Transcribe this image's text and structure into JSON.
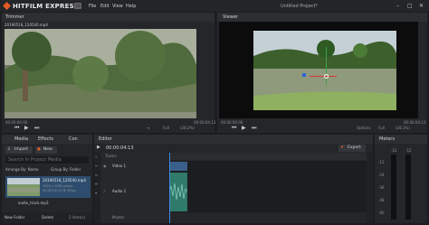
{
  "app": {
    "logo_text": "HITFILM EXPRESS",
    "logo_badge": "10",
    "menu": [
      "File",
      "Edit",
      "View",
      "Help"
    ],
    "document_title": "Untitled Project*"
  },
  "trimmer": {
    "tab": "Trimmer",
    "clip_name": "20190518_120540.mp4",
    "timecode_start": "00:00:00:00",
    "timecode_end": "00:00:04:13",
    "view_mode": "Full",
    "zoom": "(28.2%)"
  },
  "viewer": {
    "tab": "Viewer",
    "timecode_start": "00:00:00:00",
    "timecode_end": "00:00:04:13",
    "options_label": "Options",
    "view_mode": "Full",
    "zoom": "(28.1%)"
  },
  "media": {
    "tabs": [
      "Media",
      "Effects",
      "Con"
    ],
    "import_label": "Import",
    "new_label": "New",
    "search_placeholder": "Search in Project Media",
    "arrange_label": "Arrange By: Name",
    "group_label": "Group By: Folder",
    "items": [
      {
        "name": "20190518_120540.mp4",
        "details": [
          "1920 x 1080 pixels",
          "00:00:04:13 @ 30fps"
        ]
      },
      {
        "name": "audio_track.mp3",
        "details": []
      }
    ],
    "new_folder_label": "New Folder",
    "delete_label": "Delete",
    "item_count": "2 item(s)"
  },
  "editor": {
    "tab": "Editor",
    "timecode": "00:00:04:13",
    "export_label": "Export",
    "tracks_label": "Tracks",
    "video_track": "Video 1",
    "audio_track": "Audio 1",
    "master_label": "Master"
  },
  "meters": {
    "tab": "Meters",
    "scale": [
      "-12",
      "-24",
      "-36",
      "-48",
      "-60"
    ],
    "left_value": "-12",
    "right_value": "-12"
  },
  "colors": {
    "accent": "#e15b26",
    "panel": "#242629",
    "video_clip": "#3a5f8a",
    "audio_clip": "#2f7a6b"
  }
}
